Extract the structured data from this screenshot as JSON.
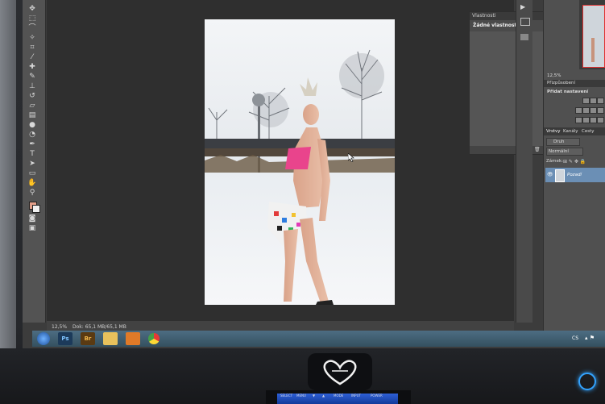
{
  "properties_panel": {
    "title": "Vlastnosti",
    "message": "Žádné vlastnosti"
  },
  "adjustments_panel": {
    "zoom": "12,5%",
    "tab": "Přizpůsobení",
    "add": "Přidat nastavení"
  },
  "layers_panel": {
    "tabs": [
      "Vrstvy",
      "Kanály",
      "Cesty"
    ],
    "filter": "Druh",
    "blend": "Normální",
    "lock": "Zámek:",
    "layer_name": "Pozadí"
  },
  "status_bar": {
    "zoom": "12,5%",
    "doc": "Dok: 65,1 MB/65,1 MB"
  },
  "taskbar": {
    "apps": [
      "Ps",
      "Br"
    ],
    "tray": "CS"
  },
  "monitor": {
    "buttons": [
      "SELECT",
      "MENU",
      "▼",
      "▲",
      "MODE",
      "INPUT",
      "POWER"
    ]
  }
}
